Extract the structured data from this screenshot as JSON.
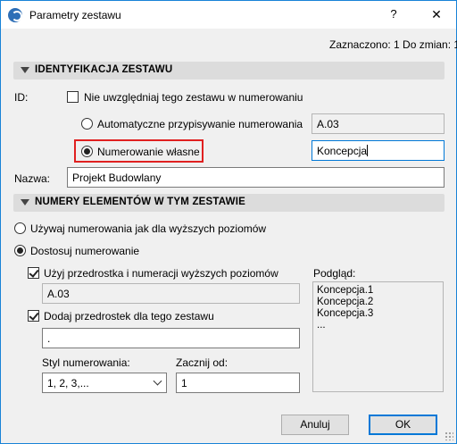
{
  "window": {
    "title": "Parametry zestawu",
    "help_label": "?",
    "close_label": "✕"
  },
  "status": {
    "text": "Zaznaczono: 1 Do zmian: 1"
  },
  "identification": {
    "header": "IDENTYFIKACJA ZESTAWU",
    "id_label": "ID:",
    "exclude_label": "Nie uwzględniaj tego zestawu w numerowaniu",
    "exclude_checked": false,
    "auto_label": "Automatyczne przypisywanie numerowania",
    "auto_value": "A.03",
    "auto_selected": false,
    "custom_label": "Numerowanie własne",
    "custom_selected": true,
    "custom_value": "Koncepcja",
    "name_label": "Nazwa:",
    "name_value": "Projekt Budowlany"
  },
  "numbering": {
    "header": "NUMERY ELEMENTÓW W TYM ZESTAWIE",
    "use_upper_label": "Używaj numerowania jak dla wyższych poziomów",
    "use_upper_selected": false,
    "customize_label": "Dostosuj numerowanie",
    "customize_selected": true,
    "prefix_upper_label": "Użyj przedrostka i numeracji wyższych poziomów",
    "prefix_upper_checked": true,
    "prefix_upper_value": "A.03",
    "own_prefix_label": "Dodaj przedrostek dla tego zestawu",
    "own_prefix_checked": true,
    "own_prefix_value": ".",
    "style_label": "Styl numerowania:",
    "style_value": "1, 2, 3,...",
    "start_label": "Zacznij od:",
    "start_value": "1",
    "preview_label": "Podgląd:",
    "preview_lines": [
      "Koncepcja.1",
      "Koncepcja.2",
      "Koncepcja.3",
      "..."
    ]
  },
  "footer": {
    "cancel_label": "Anuluj",
    "ok_label": "OK"
  },
  "colors": {
    "accent": "#0078d7",
    "highlight": "#e02020"
  }
}
